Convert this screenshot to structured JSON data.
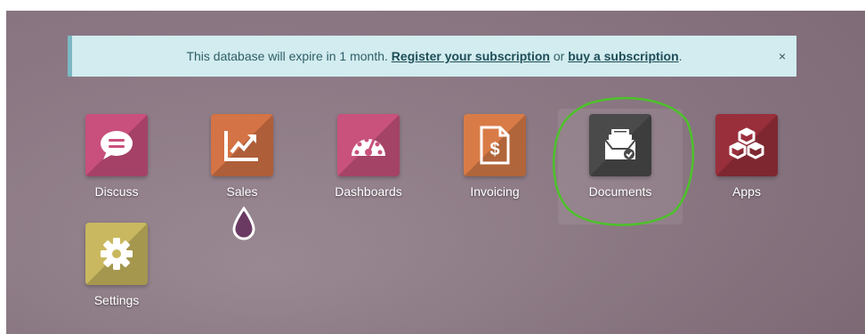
{
  "banner": {
    "text_before": "This database will expire in 1 month.",
    "register_link": "Register your subscription",
    "middle": "or",
    "buy_link": "buy a subscription",
    "end": ".",
    "close": "×"
  },
  "apps": [
    {
      "label": "Discuss",
      "icon": "chat-bubble-icon",
      "color": "#c94f7c"
    },
    {
      "label": "Sales",
      "icon": "trend-chart-icon",
      "color": "#d47345"
    },
    {
      "label": "Dashboards",
      "icon": "gauge-icon",
      "color": "#c8527c"
    },
    {
      "label": "Invoicing",
      "icon": "invoice-dollar-icon",
      "color": "#d87b47"
    },
    {
      "label": "Documents",
      "icon": "document-inbox-icon",
      "color": "#4a4a4a"
    },
    {
      "label": "Apps",
      "icon": "cubes-icon",
      "color": "#9a2f3c"
    },
    {
      "label": "Settings",
      "icon": "gear-icon",
      "color": "#c9b85f"
    }
  ],
  "colors": {
    "background": "#8e7a86",
    "banner_bg": "#d2ecef",
    "annotation_circle": "#4cc22a"
  }
}
